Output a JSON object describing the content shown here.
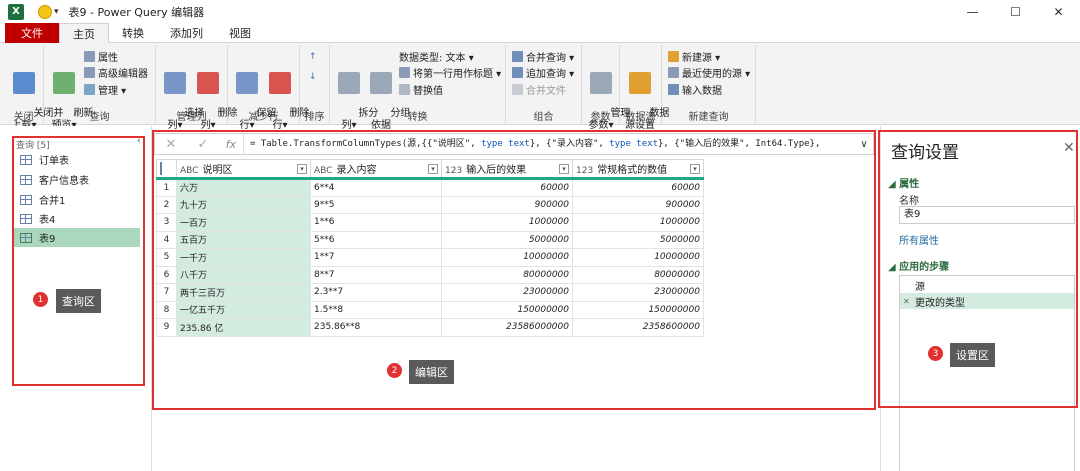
{
  "window": {
    "title": "表9 - Power Query 编辑器",
    "app_icon": "X",
    "quick_access_arrow": "▾"
  },
  "tabs": [
    {
      "label": "文件"
    },
    {
      "label": "主页"
    },
    {
      "label": "转换"
    },
    {
      "label": "添加列"
    },
    {
      "label": "视图"
    }
  ],
  "ribbon": {
    "groups": {
      "close": "关闭",
      "query": "查询",
      "manage_cols": "管理列",
      "reduce_rows": "减少行",
      "sort": "排序",
      "transform": "转换",
      "combine": "组合",
      "params": "参数",
      "datasource": "数据源",
      "newquery": "新建查询"
    },
    "buttons": {
      "close_load": "关闭并\n上载▾",
      "refresh": "刷新\n预览▾",
      "properties": "属性",
      "adv_editor": "高级编辑器",
      "manage": "管理 ▾",
      "choose_cols": "选择\n列▾",
      "remove_cols": "删除\n列▾",
      "keep_rows": "保留\n行▾",
      "remove_rows": "删除\n行▾",
      "split_col": "拆分\n列▾",
      "group_by": "分组\n依据",
      "data_type": "数据类型: 文本 ▾",
      "first_row_header": "将第一行用作标题 ▾",
      "replace": "替换值",
      "merge": "合并查询 ▾",
      "append": "追加查询 ▾",
      "combine_files": "合并文件",
      "manage_params": "管理\n参数▾",
      "ds_settings": "数据\n源设置",
      "new_source": "新建源 ▾",
      "recent_source": "最近使用的源 ▾",
      "enter_data": "输入数据"
    }
  },
  "queries": {
    "header": "查询 [5]",
    "items": [
      {
        "label": "订单表"
      },
      {
        "label": "客户信息表"
      },
      {
        "label": "合并1"
      },
      {
        "label": "表4"
      },
      {
        "label": "表9"
      }
    ],
    "selected": 4
  },
  "formula": {
    "cancel": "✕",
    "confirm": "✓",
    "fx": "fx",
    "p1": "= Table.TransformColumnTypes(源,{{\"说明区\", ",
    "k1": "type text",
    "p2": "}, {\"录入内容\", ",
    "k2": "type text",
    "p3": "}, {\"输入后的效果\", Int64.Type},",
    "chev": "∨"
  },
  "table": {
    "columns": [
      {
        "type": "ABC",
        "name": "说明区"
      },
      {
        "type": "ABC",
        "name": "录入内容"
      },
      {
        "type": "123",
        "name": "输入后的效果"
      },
      {
        "type": "123",
        "name": "常规格式的数值"
      }
    ],
    "rows": [
      [
        "1",
        "六万",
        "6**4",
        "60000",
        "60000"
      ],
      [
        "2",
        "九十万",
        "9**5",
        "900000",
        "900000"
      ],
      [
        "3",
        "一百万",
        "1**6",
        "1000000",
        "1000000"
      ],
      [
        "4",
        "五百万",
        "5**6",
        "5000000",
        "5000000"
      ],
      [
        "5",
        "一千万",
        "1**7",
        "10000000",
        "10000000"
      ],
      [
        "6",
        "八千万",
        "8**7",
        "80000000",
        "80000000"
      ],
      [
        "7",
        "两千三百万",
        "2.3**7",
        "23000000",
        "23000000"
      ],
      [
        "8",
        "一亿五千万",
        "1.5**8",
        "150000000",
        "150000000"
      ],
      [
        "9",
        "235.86 亿",
        "235.86**8",
        "23586000000",
        "2358600000"
      ]
    ]
  },
  "settings": {
    "title": "查询设置",
    "close": "✕",
    "props_header": "属性",
    "name_label": "名称",
    "name_value": "表9",
    "all_props": "所有属性",
    "steps_header": "应用的步骤",
    "steps": [
      {
        "label": "源"
      },
      {
        "label": "更改的类型"
      }
    ]
  },
  "annotations": [
    {
      "num": "1",
      "label": "查询区"
    },
    {
      "num": "2",
      "label": "编辑区"
    },
    {
      "num": "3",
      "label": "设置区"
    }
  ],
  "colors": {
    "accent": "#1ea889",
    "file_tab": "#c00000",
    "highlight": "#e03030",
    "selected": "#a9d8bf"
  }
}
